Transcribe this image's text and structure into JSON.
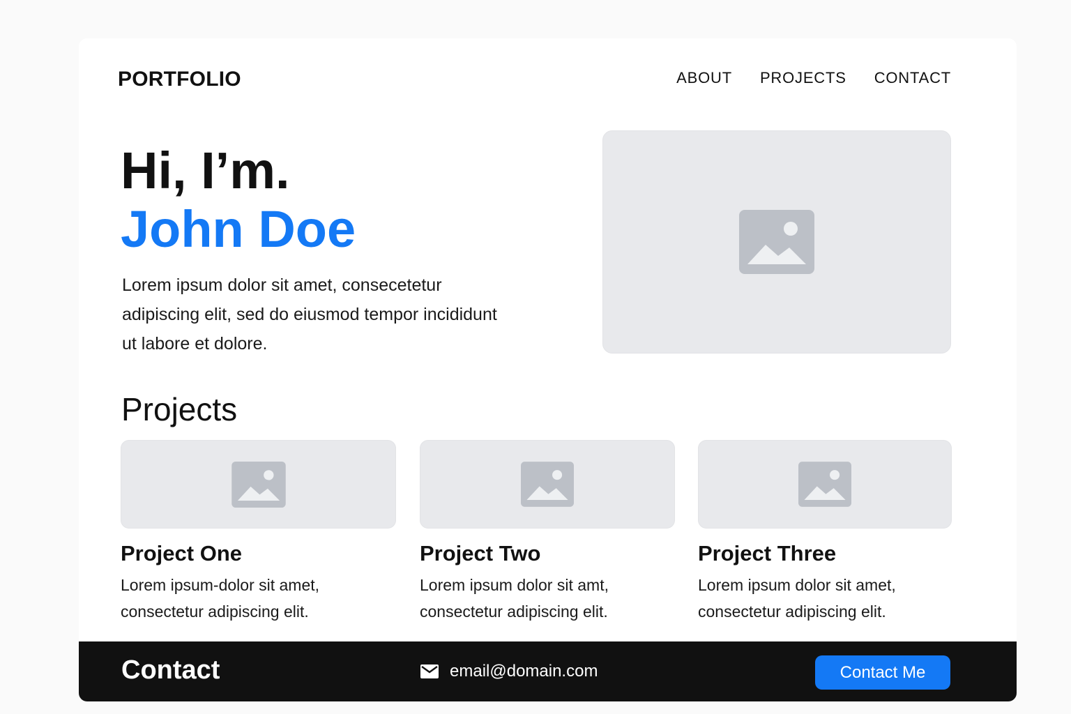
{
  "header": {
    "logo": "PORTFOLIO",
    "nav": [
      "ABOUT",
      "PROJECTS",
      "CONTACT"
    ]
  },
  "hero": {
    "greeting": "Hi, I’m.",
    "name": "John Doe",
    "description": "Lorem ipsum dolor sit amet, consecetetur adipiscing elit, sed do eiusmod tempor incididunt ut labore et dolore.",
    "image_icon": "image-placeholder-icon"
  },
  "projects": {
    "title": "Projects",
    "items": [
      {
        "title": "Project One",
        "description": "Lorem ipsum-dolor sit amet, consectetur adipiscing elit."
      },
      {
        "title": "Project Two",
        "description": "Lorem ipsum dolor sit amt, consectetur adipiscing elit."
      },
      {
        "title": "Project Three",
        "description": "Lorem ipsum dolor sit amet, consectetur adipiscing elit."
      }
    ]
  },
  "footer": {
    "title": "Contact",
    "email": "email@domain.com",
    "email_icon": "envelope-icon",
    "button_label": "Contact Me"
  },
  "colors": {
    "accent": "#1479f5",
    "footer_bg": "#111111",
    "placeholder_bg": "#e8e9ec",
    "placeholder_icon": "#bcc0c7"
  }
}
